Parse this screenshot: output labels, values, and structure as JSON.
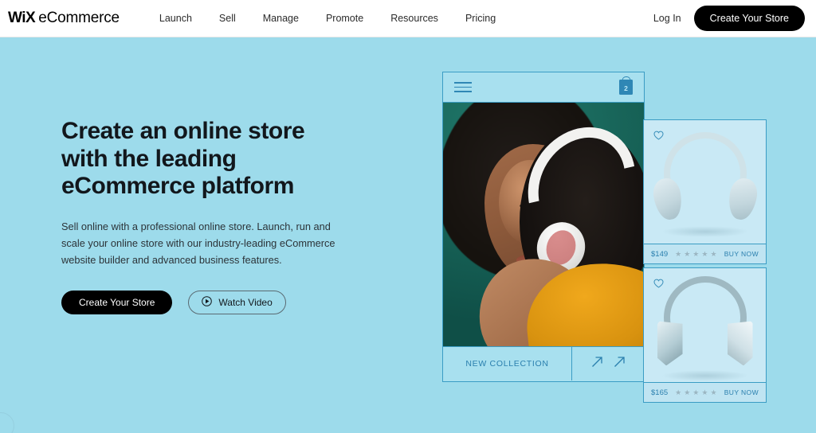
{
  "header": {
    "logo_wix": "WiX",
    "logo_ecommerce": "eCommerce",
    "nav": [
      {
        "label": "Launch"
      },
      {
        "label": "Sell"
      },
      {
        "label": "Manage"
      },
      {
        "label": "Promote"
      },
      {
        "label": "Resources"
      },
      {
        "label": "Pricing"
      }
    ],
    "login_label": "Log In",
    "cta_label": "Create Your Store"
  },
  "hero": {
    "headline_line1": "Create an online store",
    "headline_line2": "with the leading",
    "headline_line3": "eCommerce platform",
    "subtext": "Sell online with a professional online store. Launch, run and scale your online store with our industry-leading eCommerce website builder and advanced business features.",
    "primary_cta": "Create Your Store",
    "secondary_cta": "Watch Video"
  },
  "phone": {
    "menu_icon": "hamburger-icon",
    "cart_icon": "shopping-bag-icon",
    "cart_count": "2",
    "new_collection_label": "NEW COLLECTION",
    "arrow_icon_1": "arrow-up-right-icon",
    "arrow_icon_2": "arrow-up-right-icon"
  },
  "products": [
    {
      "favorite_icon": "heart-icon",
      "image": "headphones-light-blue",
      "price": "$149",
      "rating": 5,
      "buy_label": "BUY NOW"
    },
    {
      "favorite_icon": "heart-icon",
      "image": "headphones-white",
      "price": "$165",
      "rating": 5,
      "buy_label": "BUY NOW"
    }
  ],
  "star_glyph": "★",
  "colors": {
    "page_background": "#9ddbeb",
    "header_background": "#ffffff",
    "accent_dark": "#000000",
    "phone_border": "#3a9cc4",
    "phone_blue_text": "#2a7fae",
    "card_background": "#c9e9f5",
    "photo_background": "#1b7060",
    "sweater": "#e09c13"
  }
}
